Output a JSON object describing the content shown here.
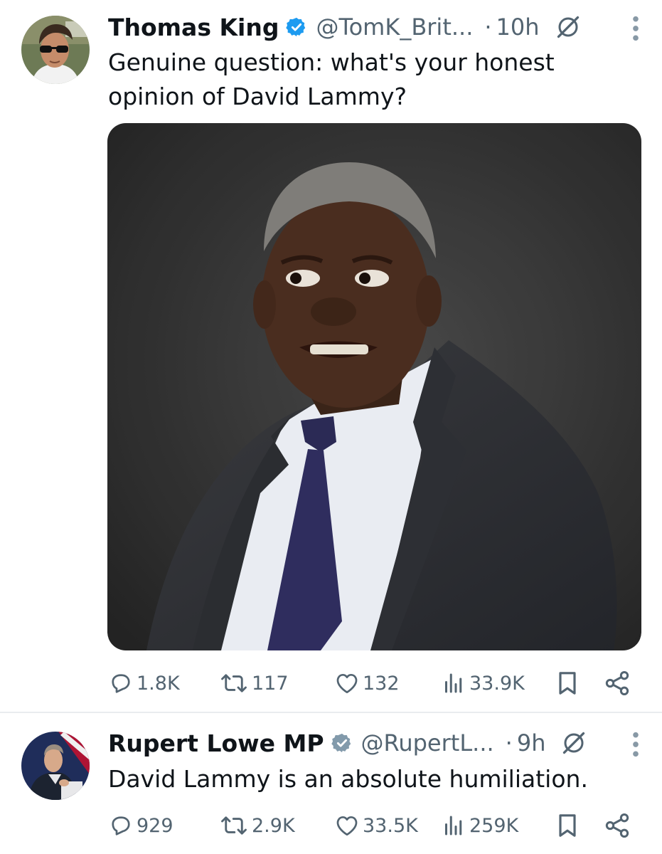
{
  "tweets": [
    {
      "author_name": "Thomas King",
      "handle": "@TomK_Brit...",
      "separator": "·",
      "time": "10h",
      "text": "Genuine question: what's your honest opinion of David Lammy?",
      "avatar_icon": "avatar-sunglasses-man",
      "media_icon": "photo-man-in-grey-suit",
      "stats": {
        "replies": "1.8K",
        "reposts": "117",
        "likes": "132",
        "views": "33.9K"
      }
    },
    {
      "author_name": "Rupert Lowe MP",
      "handle": "@RupertL...",
      "separator": "·",
      "time": "9h",
      "text": "David Lammy is an absolute humiliation.",
      "avatar_icon": "avatar-man-at-podium",
      "stats": {
        "replies": "929",
        "reposts": "2.9K",
        "likes": "33.5K",
        "views": "259K"
      }
    }
  ],
  "colors": {
    "text_primary": "#0f1419",
    "text_secondary": "#536471",
    "verified_blue": "#1d9bf0",
    "verified_grey": "#829aab",
    "divider": "#e9ecef"
  },
  "icons": [
    "verified-badge-icon",
    "grok-icon",
    "more-icon",
    "reply-icon",
    "repost-icon",
    "like-icon",
    "views-icon",
    "bookmark-icon",
    "share-icon"
  ]
}
